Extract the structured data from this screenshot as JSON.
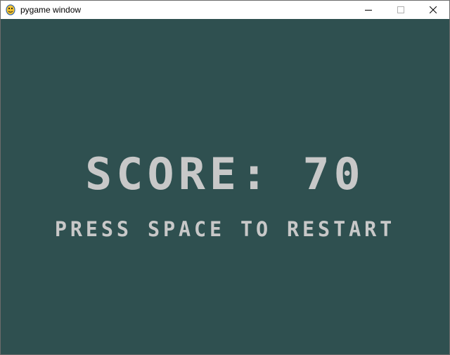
{
  "window": {
    "title": "pygame window",
    "canvas_color": "#2f5050",
    "text_color": "#c8c8c8"
  },
  "controls": {
    "minimize_icon": "minimize-icon",
    "maximize_icon": "maximize-icon",
    "close_icon": "close-icon"
  },
  "game_over": {
    "score_text": "SCORE: 70",
    "score_label": "SCORE",
    "score_value": 70,
    "restart_prompt": "PRESS SPACE TO RESTART"
  }
}
